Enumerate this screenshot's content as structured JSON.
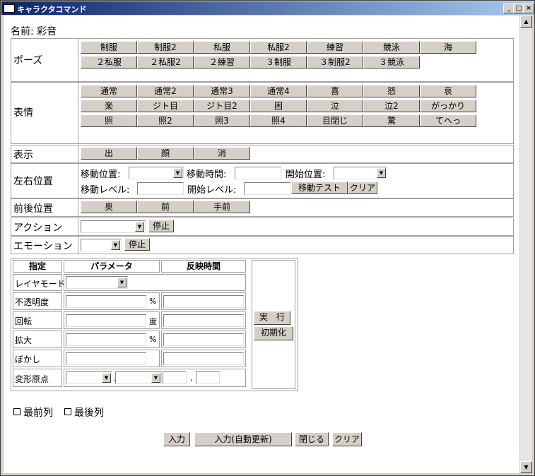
{
  "window": {
    "title": "キャラクタコマンド"
  },
  "name_label": "名前: 彩音",
  "pose": {
    "label": "ポーズ",
    "buttons": [
      "制服",
      "制服2",
      "私服",
      "私服2",
      "練習",
      "競泳",
      "海",
      "２私服",
      "２私服2",
      "２練習",
      "３制服",
      "３制服2",
      "３競泳"
    ]
  },
  "expression": {
    "label": "表情",
    "buttons": [
      "通常",
      "通常2",
      "通常3",
      "通常4",
      "喜",
      "怒",
      "哀",
      "楽",
      "ジト目",
      "ジト目2",
      "困",
      "泣",
      "泣2",
      "がっかり",
      "照",
      "照2",
      "照3",
      "照4",
      "目閉じ",
      "驚",
      "てへっ"
    ]
  },
  "display": {
    "label": "表示",
    "buttons": [
      "出",
      "顔",
      "消"
    ]
  },
  "lr": {
    "label": "左右位置",
    "move_pos": "移動位置:",
    "move_time": "移動時間:",
    "start_pos": "開始位置:",
    "move_level": "移動レベル:",
    "start_level": "開始レベル:",
    "test_button": "移動テスト",
    "clear_button": "クリア"
  },
  "depth": {
    "label": "前後位置",
    "buttons": [
      "奥",
      "前",
      "手前"
    ]
  },
  "action": {
    "label": "アクション",
    "stop_button": "停止"
  },
  "emotion": {
    "label": "エモーション",
    "stop_button": "停止"
  },
  "params": {
    "col_spec": "指定",
    "col_param": "パラメータ",
    "col_time": "反映時間",
    "layer_mode": "レイヤモード",
    "opacity": "不透明度",
    "rotation": "回転",
    "scale": "拡大",
    "blur": "ぼかし",
    "origin": "変形原点",
    "unit_percent": "%",
    "unit_degree": "度",
    "comma": ",",
    "period": ".",
    "run_button": "実　行",
    "reset_button": "初期化"
  },
  "options": {
    "front": "最前列",
    "back": "最後列"
  },
  "footer": {
    "input_button": "入力",
    "auto_button": "入力(自動更新)",
    "close_button": "閉じる",
    "clear_button": "クリア"
  }
}
